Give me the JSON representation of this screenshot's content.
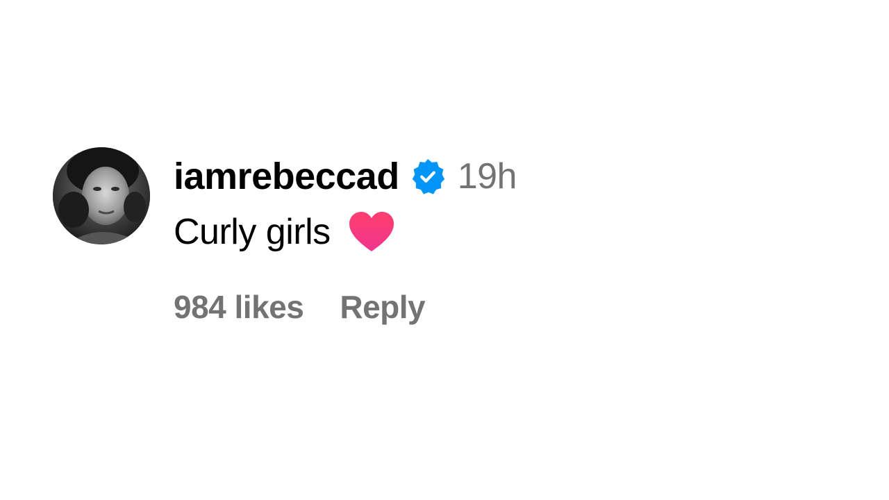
{
  "comment": {
    "username": "iamrebeccad",
    "verified_icon": "verified-badge-icon",
    "time": "19h",
    "text": "Curly girls",
    "emoji_icon": "heart-icon",
    "likes": "984 likes",
    "reply_label": "Reply",
    "colors": {
      "verified": "#0095f6",
      "heart": "#ff2d78",
      "meta_text": "#737373"
    }
  }
}
